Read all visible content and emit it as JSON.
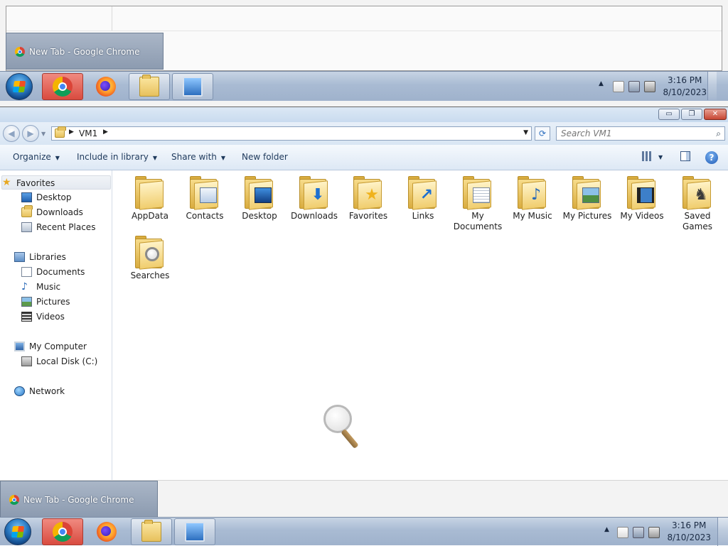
{
  "top_screenshot": {
    "preview_title": "New Tab - Google Chrome",
    "clock": {
      "time": "3:16 PM",
      "date": "8/10/2023"
    }
  },
  "taskbar": {
    "preview_title": "New Tab - Google Chrome",
    "apps": [
      {
        "name": "Google Chrome",
        "icon": "chrome-icon"
      },
      {
        "name": "Firefox",
        "icon": "firefox-icon"
      },
      {
        "name": "Windows Explorer",
        "icon": "folder-icon"
      },
      {
        "name": "Remote Desktop",
        "icon": "network-computer-icon"
      }
    ],
    "tray_chevron": "▲",
    "clock": {
      "time": "3:16 PM",
      "date": "8/10/2023"
    }
  },
  "window": {
    "buttons": {
      "minimize": "▭",
      "maximize": "❐",
      "close": "✕"
    }
  },
  "address": {
    "separator": "▶",
    "crumb": "VM1",
    "dropdown": "▼",
    "refresh": "⟳"
  },
  "search": {
    "placeholder": "Search VM1",
    "icon": "search-icon"
  },
  "toolbar": {
    "organize": "Organize",
    "include_in_library": "Include in library",
    "share_with": "Share with",
    "new_folder": "New folder",
    "arrow": "▼",
    "help": "?"
  },
  "nav": {
    "favorites": "Favorites",
    "desktop": "Desktop",
    "downloads": "Downloads",
    "recent_places": "Recent Places",
    "libraries": "Libraries",
    "documents": "Documents",
    "music": "Music",
    "pictures": "Pictures",
    "videos": "Videos",
    "my_computer": "My Computer",
    "local_disk": "Local Disk (C:)",
    "network": "Network"
  },
  "folders": [
    {
      "label": "AppData",
      "icon": "folder-icon"
    },
    {
      "label": "Contacts",
      "icon": "contacts-folder-icon"
    },
    {
      "label": "Desktop",
      "icon": "desktop-folder-icon"
    },
    {
      "label": "Downloads",
      "icon": "downloads-folder-icon"
    },
    {
      "label": "Favorites",
      "icon": "favorites-folder-icon"
    },
    {
      "label": "Links",
      "icon": "links-folder-icon"
    },
    {
      "label": "My Documents",
      "icon": "documents-folder-icon"
    },
    {
      "label": "My Music",
      "icon": "music-folder-icon"
    },
    {
      "label": "My Pictures",
      "icon": "pictures-folder-icon"
    },
    {
      "label": "My Videos",
      "icon": "videos-folder-icon"
    },
    {
      "label": "Saved Games",
      "icon": "saved-games-folder-icon"
    },
    {
      "label": "Searches",
      "icon": "searches-folder-icon"
    }
  ]
}
